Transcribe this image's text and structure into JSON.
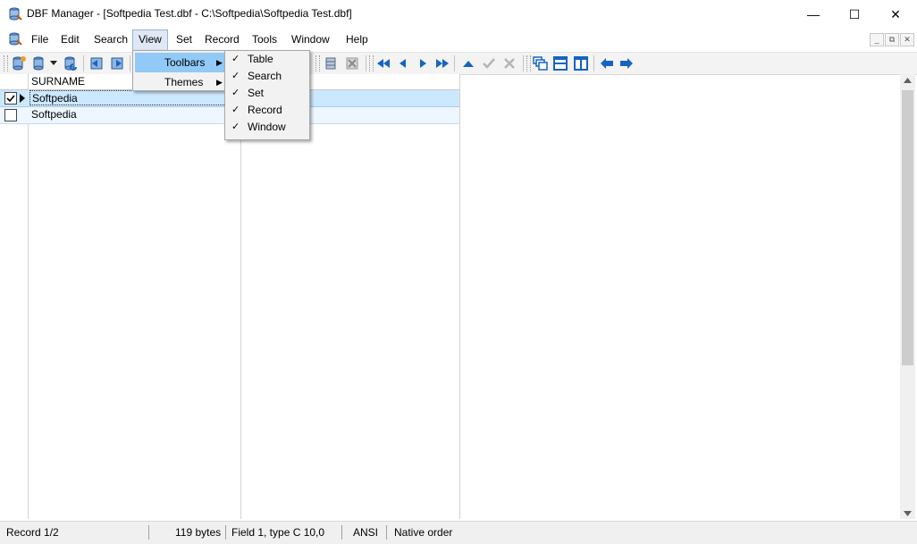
{
  "window": {
    "title": "DBF Manager - [Softpedia Test.dbf - C:\\Softpedia\\Softpedia Test.dbf]",
    "minimize_glyph": "—",
    "maximize_glyph": "☐",
    "close_glyph": "✕"
  },
  "menubar": {
    "items": [
      "File",
      "Edit",
      "Search",
      "View",
      "Set",
      "Record",
      "Tools",
      "Window",
      "Help"
    ],
    "active": "View",
    "mdi_buttons": [
      "_",
      "⧉",
      "✕"
    ]
  },
  "view_menu": {
    "items": [
      {
        "label": "Toolbars",
        "submenu": true,
        "highlighted": true
      },
      {
        "label": "Themes",
        "submenu": true,
        "highlighted": false
      }
    ]
  },
  "toolbars_submenu": {
    "items": [
      {
        "label": "Table",
        "checked": true
      },
      {
        "label": "Search",
        "checked": true
      },
      {
        "label": "Set",
        "checked": true
      },
      {
        "label": "Record",
        "checked": true
      },
      {
        "label": "Window",
        "checked": true
      }
    ]
  },
  "toolbar": {
    "icons": [
      "new-table-icon",
      "open-table-icon",
      "dropdown-arrow-icon",
      "refresh-table-icon",
      "import-icon",
      "export-icon",
      "table-props-icon",
      "delete-table-icon",
      "first-record-icon",
      "prior-record-icon",
      "next-record-icon",
      "last-record-icon",
      "edit-up-icon",
      "post-check-icon",
      "cancel-x-icon",
      "cascade-windows-icon",
      "tile-horizontal-icon",
      "tile-vertical-icon",
      "back-arrow-icon",
      "forward-arrow-icon"
    ]
  },
  "grid": {
    "columns": [
      "SURNAME"
    ],
    "rows": [
      {
        "value": "Softpedia",
        "checked": true,
        "current": true
      },
      {
        "value": "Softpedia",
        "checked": false,
        "current": false
      }
    ]
  },
  "statusbar": {
    "record": "Record 1/2",
    "size": "119 bytes",
    "field": "Field 1, type C 10,0",
    "charset": "ANSI",
    "order": "Native order"
  },
  "colors": {
    "accent_blue": "#1565c0",
    "menu_highlight": "#91c9f7",
    "row_highlight": "#cce8ff"
  }
}
